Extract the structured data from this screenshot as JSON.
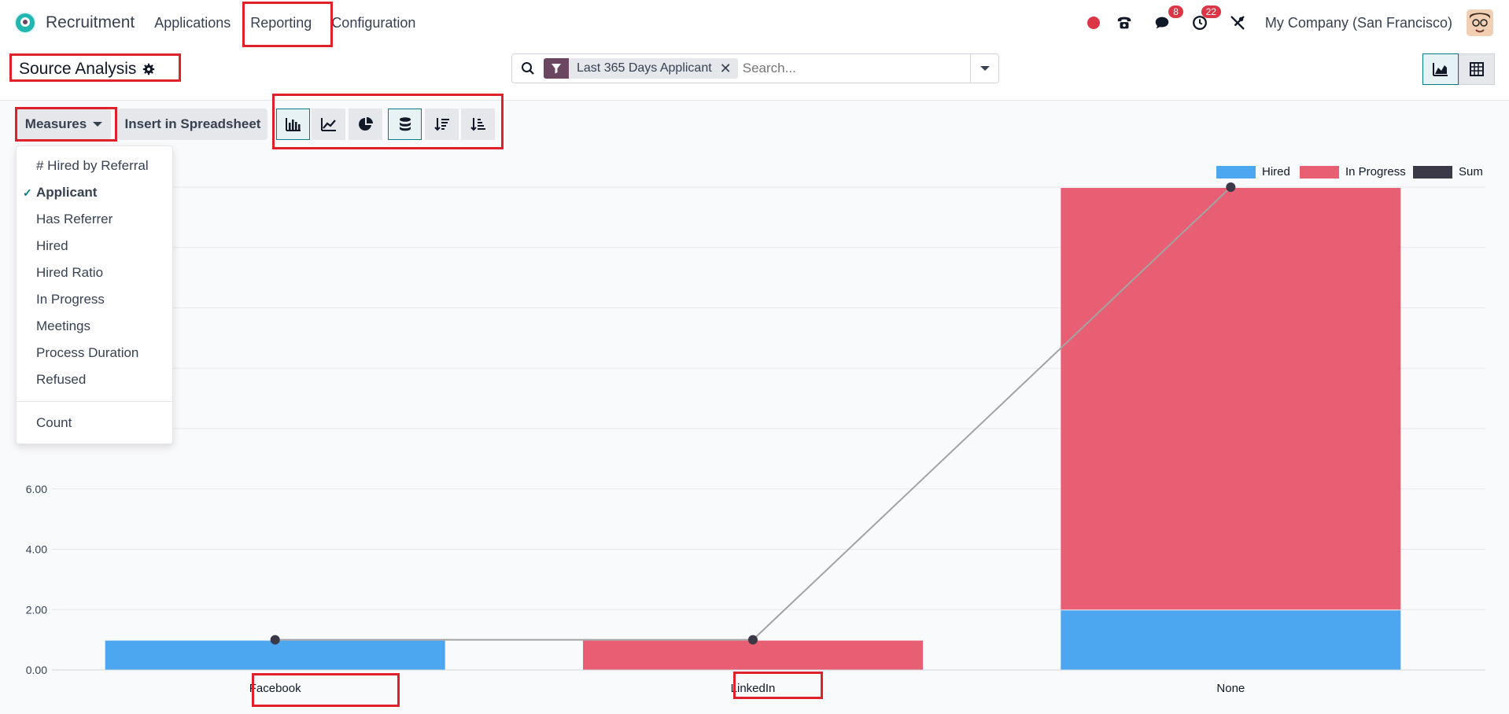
{
  "app": {
    "name": "Recruitment",
    "nav": [
      "Applications",
      "Reporting",
      "Configuration"
    ],
    "company": "My Company (San Francisco)",
    "badges": {
      "messages": "8",
      "activities": "22"
    }
  },
  "page": {
    "title": "Source Analysis"
  },
  "search": {
    "facet_label": "Last 365 Days Applicant",
    "placeholder": "Search..."
  },
  "toolbar": {
    "measures_label": "Measures",
    "insert_label": "Insert in Spreadsheet"
  },
  "measures": {
    "items": [
      {
        "label": "# Hired by Referral",
        "selected": false
      },
      {
        "label": "Applicant",
        "selected": true
      },
      {
        "label": "Has Referrer",
        "selected": false
      },
      {
        "label": "Hired",
        "selected": false
      },
      {
        "label": "Hired Ratio",
        "selected": false
      },
      {
        "label": "In Progress",
        "selected": false
      },
      {
        "label": "Meetings",
        "selected": false
      },
      {
        "label": "Process Duration",
        "selected": false
      },
      {
        "label": "Refused",
        "selected": false
      }
    ],
    "extra": "Count"
  },
  "colors": {
    "hired": "#4da6f0",
    "in_progress": "#e85f74",
    "sum": "#3b3848",
    "highlight": "#e0202a",
    "accent": "#017e84"
  },
  "chart_data": {
    "type": "bar",
    "stacked": true,
    "categories": [
      "Facebook",
      "LinkedIn",
      "None"
    ],
    "series": [
      {
        "name": "Hired",
        "values": [
          1,
          0,
          2
        ]
      },
      {
        "name": "In Progress",
        "values": [
          0,
          1,
          14
        ]
      },
      {
        "name": "Sum",
        "type": "line",
        "values": [
          1,
          1,
          16
        ]
      }
    ],
    "yticks": [
      "0.00",
      "2.00",
      "4.00",
      "6.00"
    ],
    "ylim": [
      0,
      16
    ],
    "grid": true,
    "legend_position": "top-right"
  }
}
